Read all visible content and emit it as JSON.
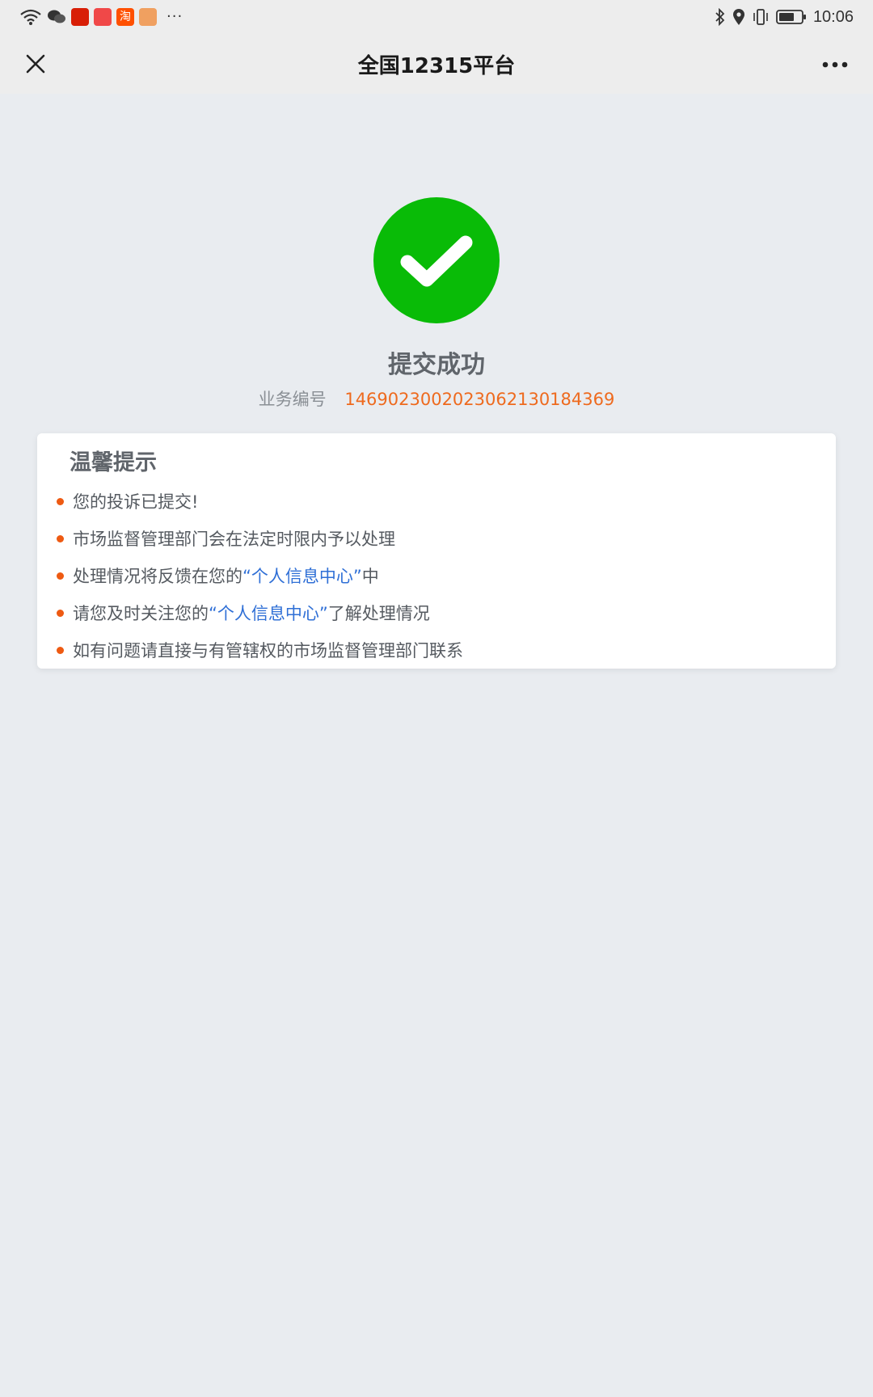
{
  "status_bar": {
    "time": "10:06",
    "left_icons": [
      "wifi-icon",
      "wechat-icon",
      "app-red-icon",
      "app-red-icon",
      "taobao-icon",
      "message-icon"
    ],
    "app_labels": {
      "taobao": "淘"
    },
    "more": "···",
    "right_icons": [
      "bluetooth-icon",
      "location-icon",
      "vibrate-icon",
      "battery-icon"
    ]
  },
  "nav": {
    "title": "全国12315平台",
    "close_icon": "close-icon",
    "more_icon": "more-icon"
  },
  "result": {
    "icon": "check-circle-icon",
    "icon_color": "#09bb07",
    "title": "提交成功",
    "biz_label": "业务编号",
    "biz_number": "14690230020230621301843​69",
    "biz_number_color": "#ee6a1e"
  },
  "notice": {
    "title": "温馨提示",
    "tips": [
      {
        "text": "您的投诉已提交!"
      },
      {
        "text": "市场监督管理部门会在法定时限内予以处理"
      },
      {
        "before": "处理情况将反馈在您的",
        "link": "“个人信息中心”",
        "after": "中"
      },
      {
        "before": "请您及时关注您的",
        "link": "“个人信息中心”",
        "after": "了解处理情况"
      },
      {
        "text": "如有问题请直接与有管辖权的市场监督管理部门联系"
      }
    ],
    "bullet_color": "#ee5a12",
    "link_color": "#2f6fd6"
  }
}
